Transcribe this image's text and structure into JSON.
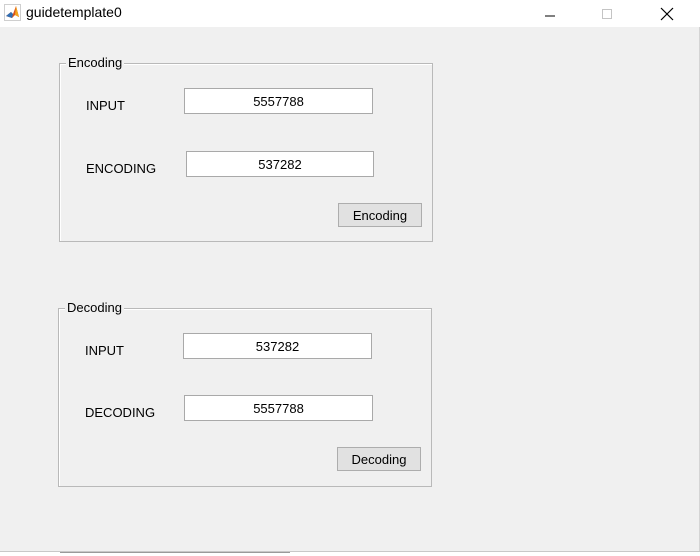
{
  "window": {
    "title": "guidetemplate0",
    "icons": {
      "app": "matlab-icon",
      "minimize": "minimize-icon",
      "maximize": "maximize-icon",
      "close": "close-icon"
    }
  },
  "encoding_panel": {
    "title": "Encoding",
    "input_label": "INPUT",
    "input_value": "5557788",
    "output_label": "ENCODING",
    "output_value": "537282",
    "button_label": "Encoding"
  },
  "decoding_panel": {
    "title": "Decoding",
    "input_label": "INPUT",
    "input_value": "537282",
    "output_label": "DECODING",
    "output_value": "5557788",
    "button_label": "Decoding"
  }
}
